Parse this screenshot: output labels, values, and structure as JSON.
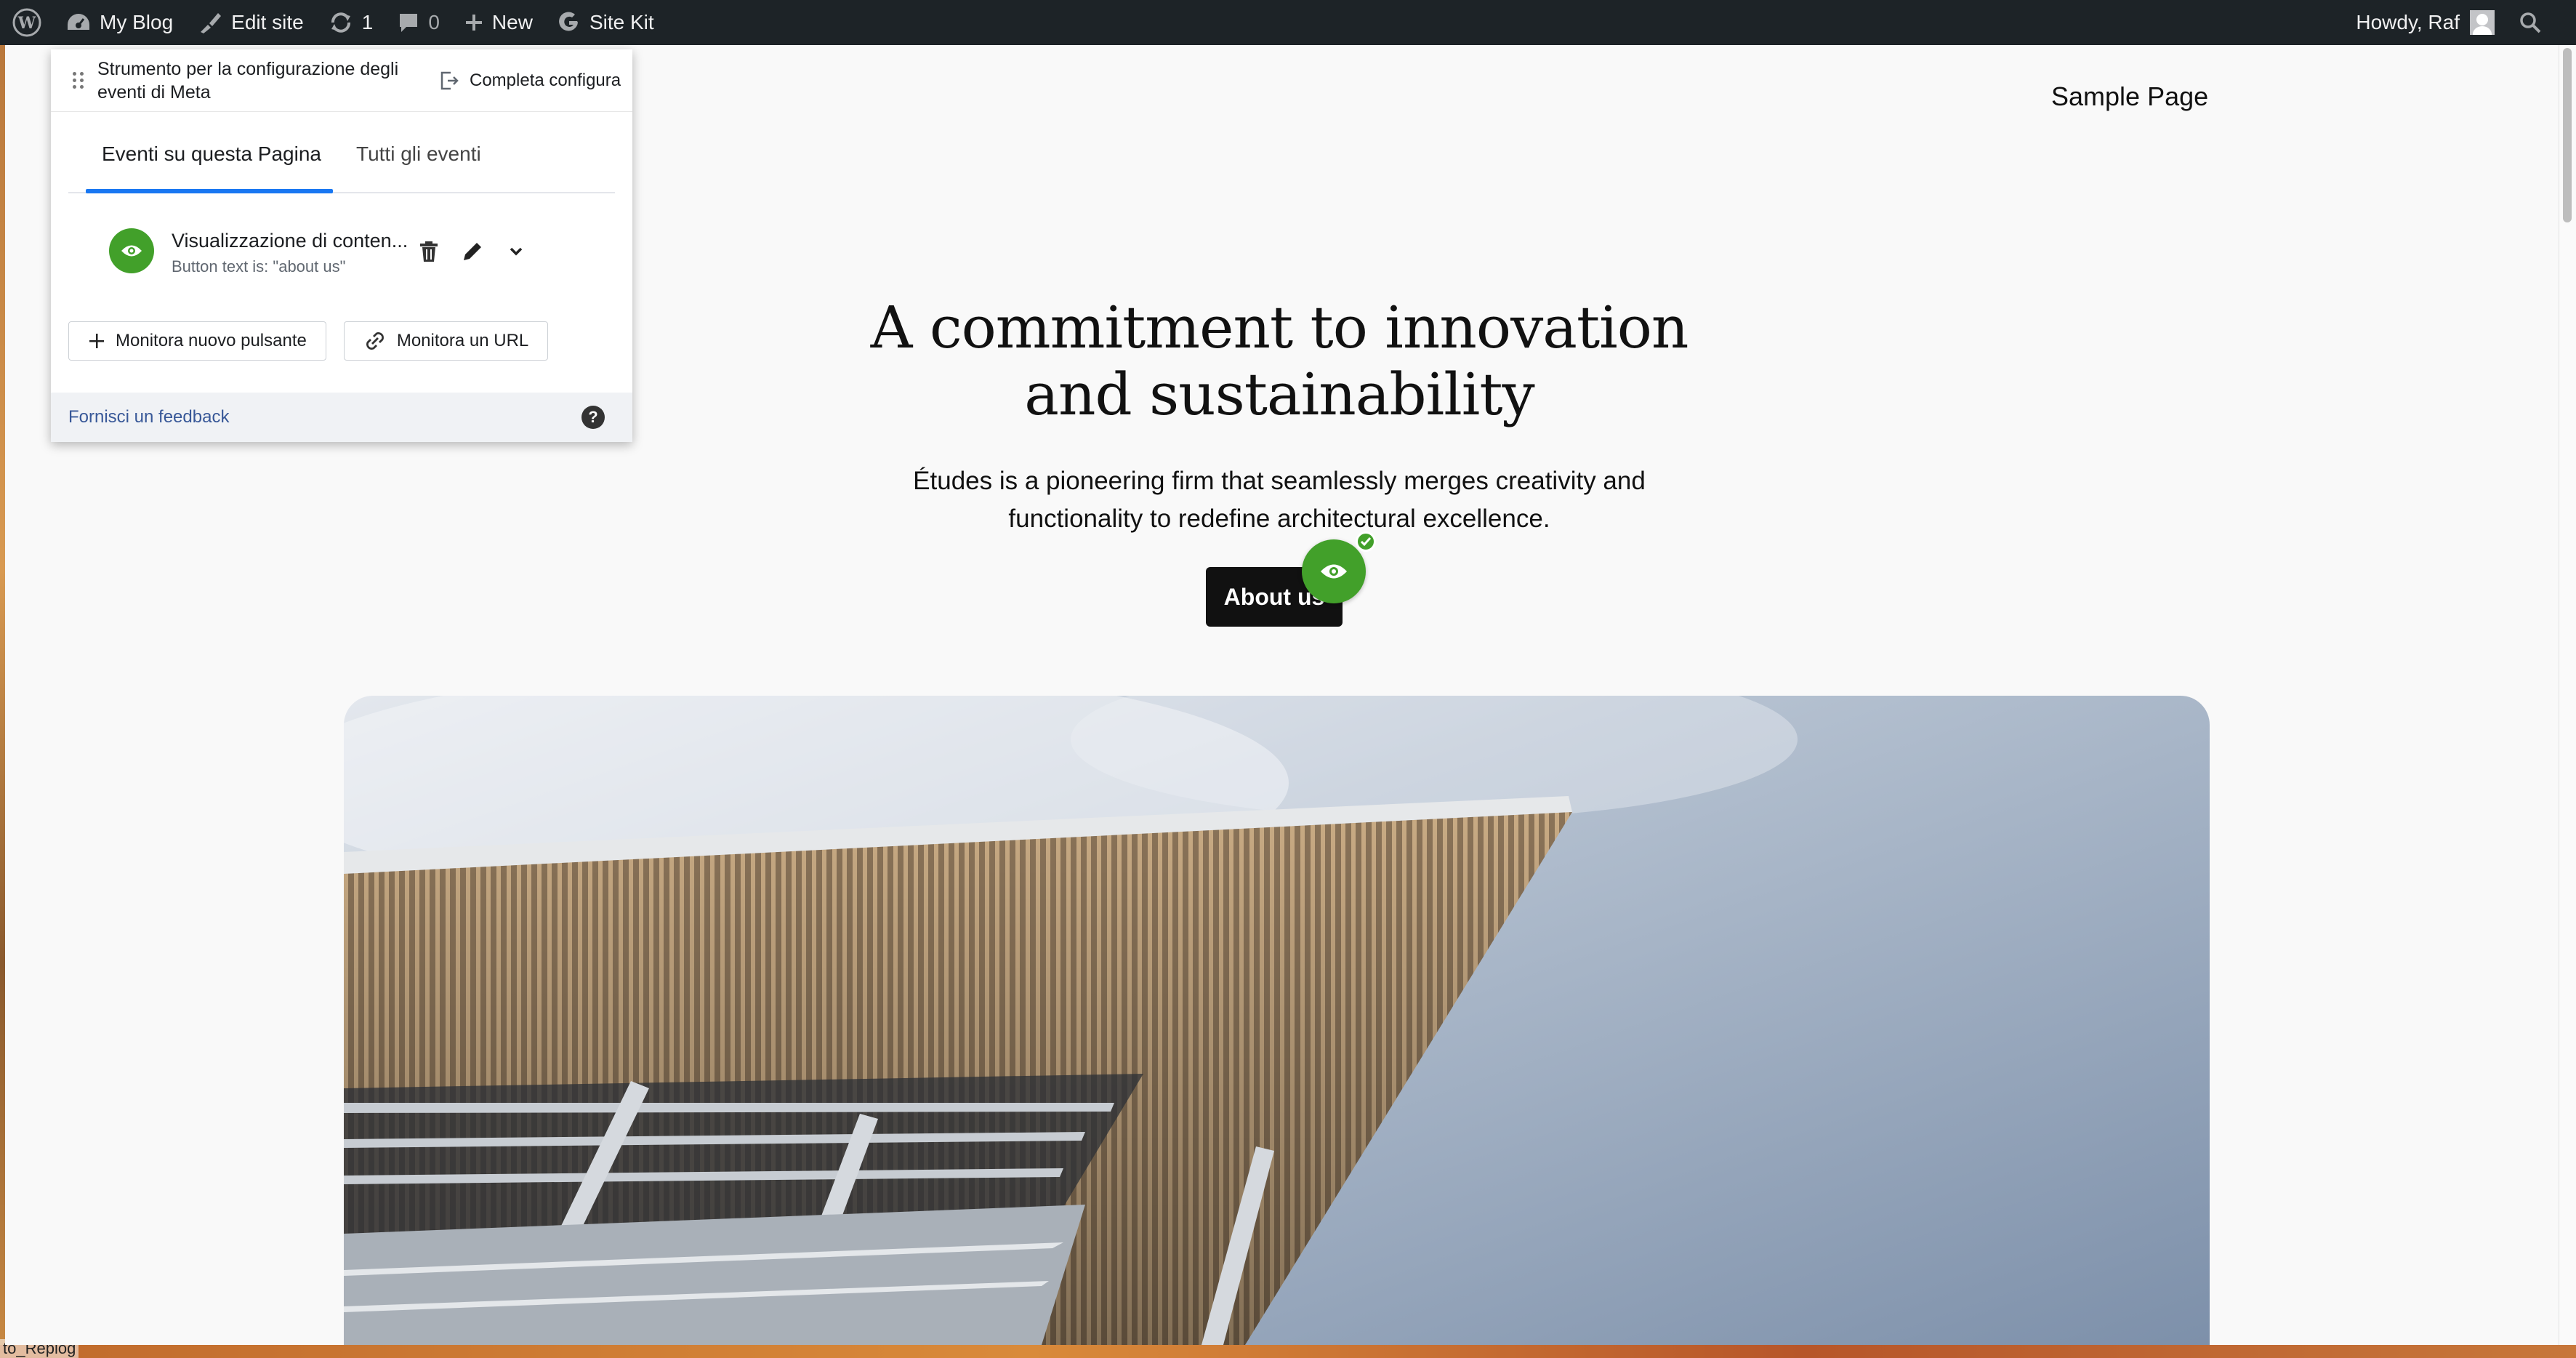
{
  "admin_bar": {
    "my_blog": "My Blog",
    "edit_site": "Edit site",
    "updates_count": "1",
    "comments_count": "0",
    "new_label": "New",
    "site_kit": "Site Kit",
    "howdy": "Howdy, Raf"
  },
  "site": {
    "nav_link": "Sample Page",
    "hero_title_line1": "A commitment to innovation",
    "hero_title_line2": "and sustainability",
    "hero_text_line1": "Études is a pioneering firm that seamlessly merges creativity and",
    "hero_text_line2": "functionality to redefine architectural excellence.",
    "cta_button": "About us"
  },
  "meta_panel": {
    "title": "Strumento per la configurazione degli eventi di Meta",
    "complete_setup": "Completa configura",
    "tabs": [
      {
        "label": "Eventi su questa Pagina",
        "active": true
      },
      {
        "label": "Tutti gli eventi",
        "active": false
      }
    ],
    "event": {
      "name": "Visualizzazione di conten...",
      "condition": "Button text is: \"about us\""
    },
    "track_button": "Monitora nuovo pulsante",
    "track_url": "Monitora un URL",
    "feedback": "Fornisci un feedback",
    "help": "?"
  },
  "desktop": {
    "dock_label": "to_Replog"
  },
  "colors": {
    "admin_bar": "#1d2327",
    "event_green": "#42a02a",
    "tab_blue": "#1877f2",
    "link_blue": "#385898"
  }
}
